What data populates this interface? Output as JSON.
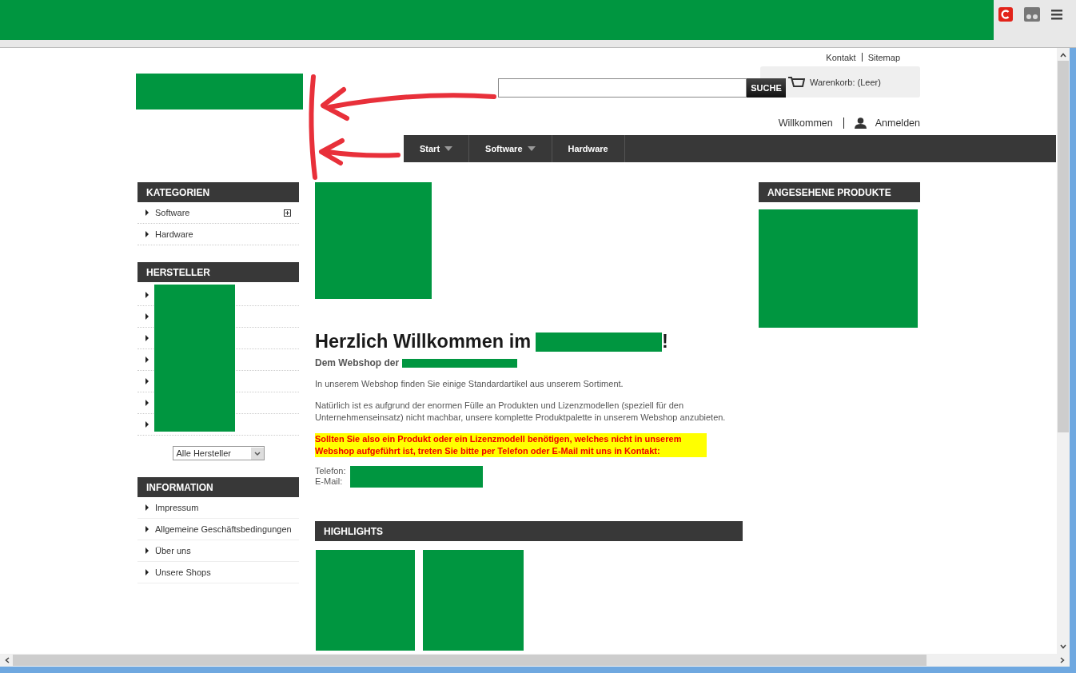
{
  "top_links": [
    "Kontakt",
    "Sitemap"
  ],
  "search": {
    "button": "SUCHE"
  },
  "cart": {
    "label": "Warenkorb: (Leer)"
  },
  "account": {
    "greeting": "Willkommen",
    "login": "Anmelden"
  },
  "nav": [
    {
      "label": "Start",
      "has_menu": true
    },
    {
      "label": "Software",
      "has_menu": true
    },
    {
      "label": "Hardware",
      "has_menu": false
    }
  ],
  "categories": {
    "title": "KATEGORIEN",
    "items": [
      {
        "label": "Software",
        "expandable": true
      },
      {
        "label": "Hardware",
        "expandable": false
      }
    ]
  },
  "manufacturers": {
    "title": "HERSTELLER",
    "items": [
      {
        "kind": "redacted"
      },
      {
        "kind": "redacted"
      },
      {
        "kind": "redacted"
      },
      {
        "kind": "redacted"
      },
      {
        "kind": "redacted"
      },
      {
        "kind": "redacted"
      },
      {
        "kind": "redacted"
      }
    ],
    "select": "Alle Hersteller"
  },
  "information": {
    "title": "INFORMATION",
    "items": [
      "Impressum",
      "Allgemeine Geschäftsbedingungen",
      "Über uns",
      "Unsere Shops"
    ]
  },
  "welcome": {
    "heading": "Herzlich Willkommen im",
    "heading_end": "!",
    "subtitle": "Dem Webshop der",
    "paragraphs": [
      "In unserem Webshop finden Sie einige Standardartikel aus unserem Sortiment.",
      "Natürlich ist es aufgrund der enormen Fülle an Produkten und Lizenzmodellen (speziell für den Unternehmenseinsatz) nicht machbar, unsere komplette Produktpalette in unserem Webshop anzubieten."
    ],
    "notice": "Sollten Sie also ein Produkt oder ein Lizenzmodell benötigen, welches nicht in unserem Webshop aufgeführt ist, treten Sie bitte per Telefon oder E-Mail mit uns in Kontakt:",
    "contacts": [
      "Telefon:",
      "E-Mail:"
    ]
  },
  "highlights": {
    "title": "HIGHLIGHTS"
  },
  "viewed": {
    "title": "ANGESEHENE PRODUKTE"
  }
}
